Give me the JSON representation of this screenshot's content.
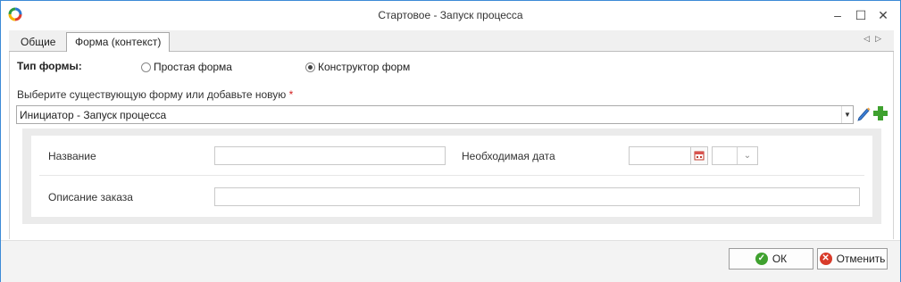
{
  "window": {
    "title": "Стартовое - Запуск процесса",
    "controls": {
      "minimize": "–",
      "maximize": "☐",
      "close": "✕"
    }
  },
  "tabs": [
    {
      "label": "Общие",
      "active": false
    },
    {
      "label": "Форма (контекст)",
      "active": true
    }
  ],
  "tab_scroll": {
    "left": "◁",
    "right": "▷"
  },
  "form_type": {
    "label": "Тип формы:",
    "options": [
      {
        "label": "Простая форма",
        "selected": false
      },
      {
        "label": "Конструктор форм",
        "selected": true
      }
    ]
  },
  "form_select": {
    "label": "Выберите существующую форму или добавьте новую",
    "required_mark": "*",
    "value": "Инициатор - Запуск процесса",
    "dropdown_glyph": "▼"
  },
  "preview": {
    "name_label": "Название",
    "name_value": "",
    "date_label": "Необходимая дата",
    "date_value": "",
    "time_value": "",
    "time_glyph": "⌄",
    "desc_label": "Описание заказа",
    "desc_value": ""
  },
  "footer": {
    "ok_label": "ОК",
    "cancel_label": "Отменить",
    "ok_glyph": "✓",
    "cancel_glyph": "✕"
  },
  "colors": {
    "window_border": "#3c8ad6",
    "ok_icon": "#3fa12f",
    "cancel_icon": "#d83b2a",
    "required": "#d32020"
  }
}
